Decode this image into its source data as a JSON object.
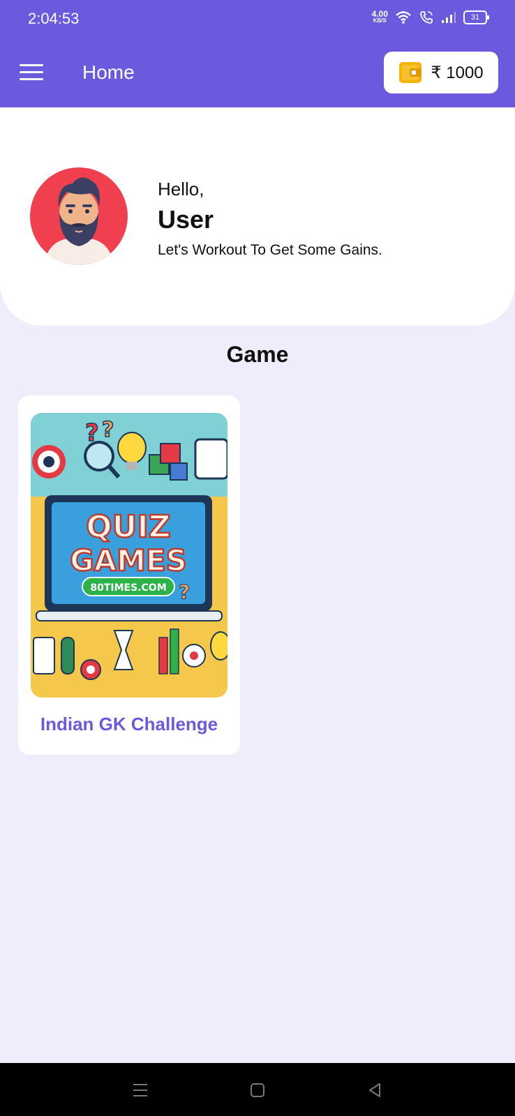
{
  "status_bar": {
    "time": "2:04:53",
    "net_speed_value": "4.00",
    "net_speed_unit": "KB/S",
    "battery": "31",
    "icons": [
      "wifi-icon",
      "wifi-call-icon",
      "signal-icon",
      "battery-icon"
    ]
  },
  "app_bar": {
    "title": "Home",
    "menu_icon": "hamburger-menu-icon",
    "wallet": {
      "icon": "wallet-icon",
      "amount": "₹ 1000"
    }
  },
  "profile": {
    "greeting": "Hello,",
    "name": "User",
    "tagline": "Let's Workout To Get Some Gains."
  },
  "section": {
    "title": "Game"
  },
  "games": [
    {
      "title": "Indian GK Challenge",
      "thumbnail_text": {
        "line1": "QUIZ",
        "line2": "GAMES",
        "badge": "80TIMES.COM"
      }
    }
  ],
  "nav": {
    "icons": [
      "recent-apps-icon",
      "home-icon",
      "back-icon"
    ]
  },
  "colors": {
    "primary": "#6b5add",
    "background": "#efedfb",
    "wallet_icon": "#f5b400"
  }
}
